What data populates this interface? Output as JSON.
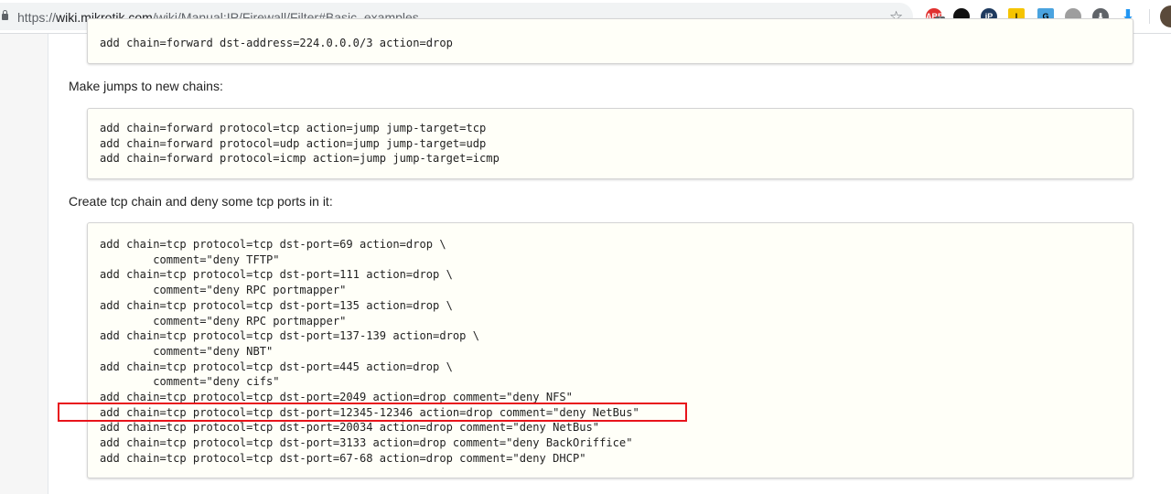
{
  "browser": {
    "url_prefix": "https://",
    "url_domain": "wiki.mikrotik.com",
    "url_path": "/wiki/Manual:IP/Firewall/Filter#Basic_examples",
    "extensions": [
      {
        "name": "adblock",
        "label": "ABP",
        "badge": "1",
        "color": "#e0312f"
      },
      {
        "name": "tampermonkey",
        "label": "",
        "color": "#111111"
      },
      {
        "name": "ip",
        "label": "iP",
        "color": "#1e3a5f"
      },
      {
        "name": "yellow-ext",
        "label": "l",
        "color": "#f5c400"
      },
      {
        "name": "google-translate",
        "label": "G",
        "color": "#4aa3df"
      },
      {
        "name": "speech",
        "label": "",
        "color": "#9e9e9e"
      },
      {
        "name": "download",
        "label": "⬇",
        "color": "#5f6368"
      },
      {
        "name": "blue-download",
        "label": "⬇",
        "color": "#2196f3"
      }
    ]
  },
  "content": {
    "block1": [
      "add chain=forward dst-address=224.0.0.0/3 action=drop"
    ],
    "para2": "Make jumps to new chains:",
    "block2": [
      "add chain=forward protocol=tcp action=jump jump-target=tcp",
      "add chain=forward protocol=udp action=jump jump-target=udp",
      "add chain=forward protocol=icmp action=jump jump-target=icmp"
    ],
    "para3": "Create tcp chain and deny some tcp ports in it:",
    "block3": [
      "add chain=tcp protocol=tcp dst-port=69 action=drop \\",
      "        comment=\"deny TFTP\"",
      "add chain=tcp protocol=tcp dst-port=111 action=drop \\",
      "        comment=\"deny RPC portmapper\"",
      "add chain=tcp protocol=tcp dst-port=135 action=drop \\",
      "        comment=\"deny RPC portmapper\"",
      "add chain=tcp protocol=tcp dst-port=137-139 action=drop \\",
      "        comment=\"deny NBT\"",
      "add chain=tcp protocol=tcp dst-port=445 action=drop \\",
      "        comment=\"deny cifs\"",
      "add chain=tcp protocol=tcp dst-port=2049 action=drop comment=\"deny NFS\"",
      "add chain=tcp protocol=tcp dst-port=12345-12346 action=drop comment=\"deny NetBus\"",
      "add chain=tcp protocol=tcp dst-port=20034 action=drop comment=\"deny NetBus\"",
      "add chain=tcp protocol=tcp dst-port=3133 action=drop comment=\"deny BackOriffice\"",
      "add chain=tcp protocol=tcp dst-port=67-68 action=drop comment=\"deny DHCP\""
    ],
    "highlight_color": "#e8141b"
  }
}
